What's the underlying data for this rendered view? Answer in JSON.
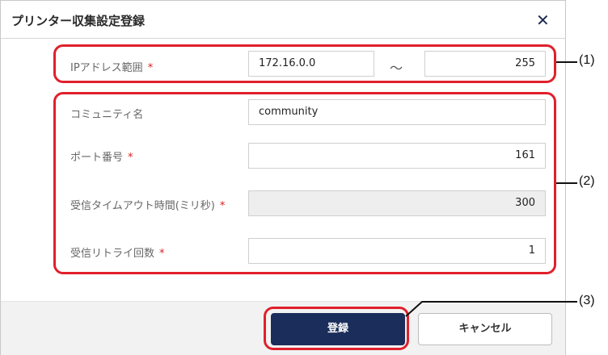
{
  "dialog": {
    "title": "プリンター収集設定登録",
    "close_symbol": "✕"
  },
  "ip_range": {
    "label": "IPアドレス範囲",
    "required_mark": "*",
    "start_value": "172.16.0.0",
    "separator": "～",
    "end_value": "255"
  },
  "community": {
    "label": "コミュニティ名",
    "value": "community"
  },
  "port": {
    "label": "ポート番号",
    "required_mark": "*",
    "value": "161"
  },
  "timeout": {
    "label": "受信タイムアウト時間(ミリ秒)",
    "required_mark": "*",
    "value": "300"
  },
  "retry": {
    "label": "受信リトライ回数",
    "required_mark": "*",
    "value": "1"
  },
  "footer": {
    "register_label": "登録",
    "cancel_label": "キャンセル"
  },
  "callouts": {
    "c1": "(1)",
    "c2": "(2)",
    "c3": "(3)"
  },
  "colors": {
    "primary": "#1b2d5a",
    "highlight": "#e0202c",
    "required": "#d62020"
  },
  "icons": {
    "close": "close-icon"
  }
}
